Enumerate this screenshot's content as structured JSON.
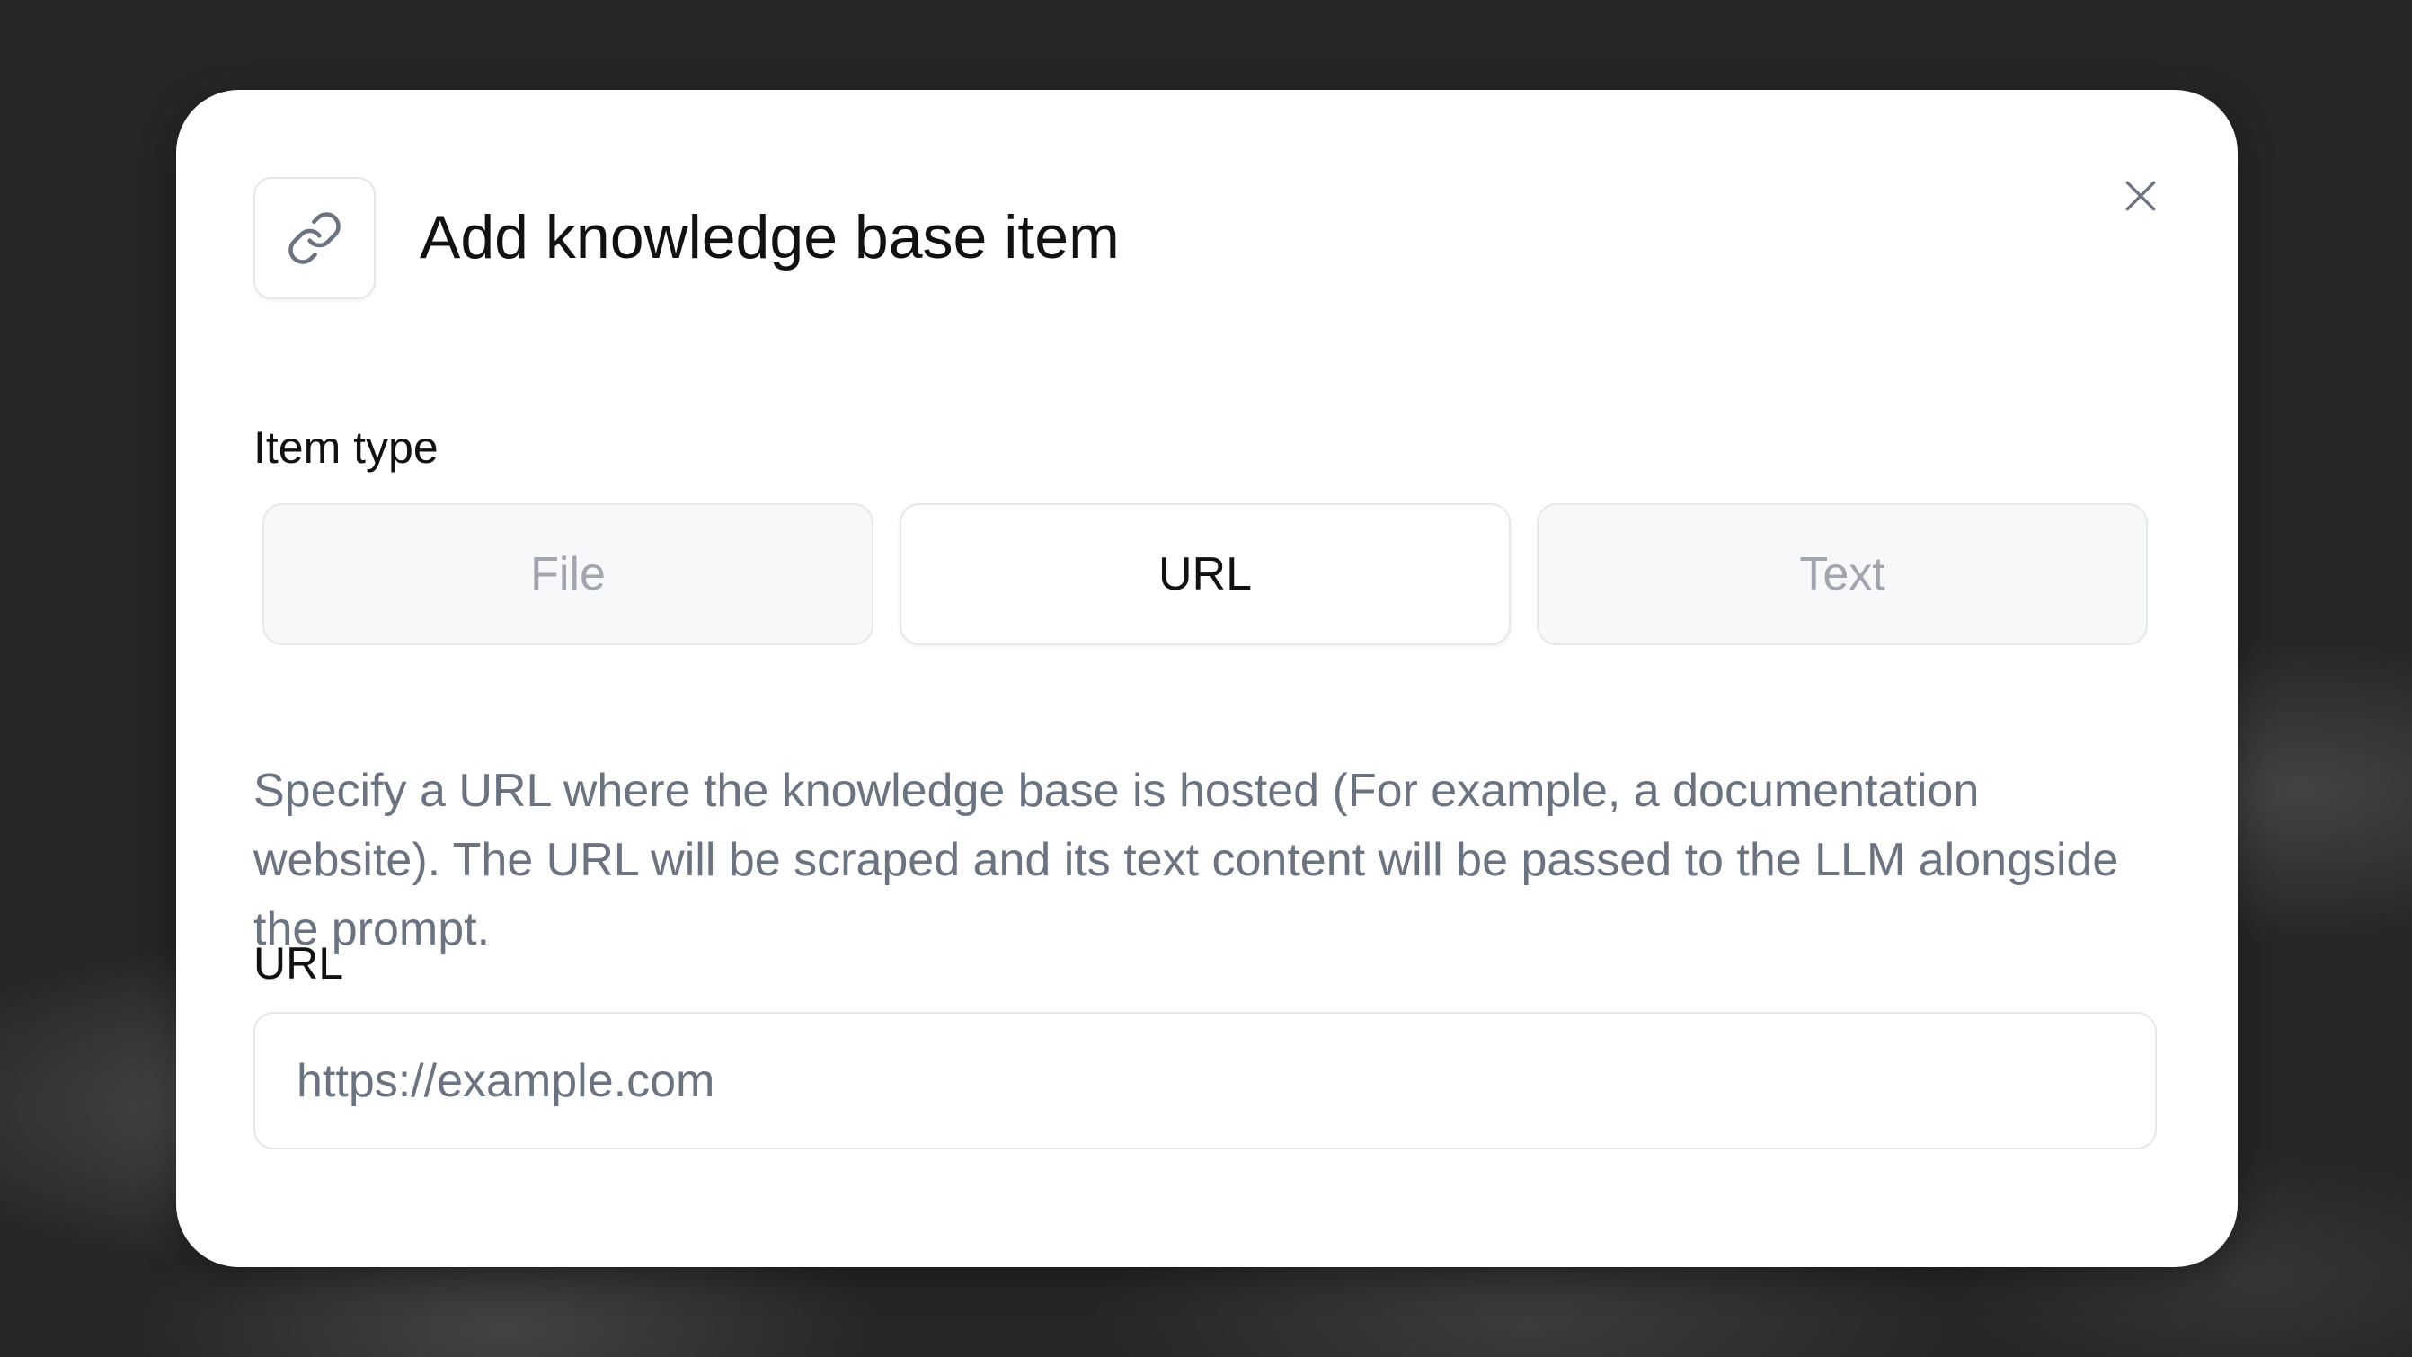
{
  "dialog": {
    "title": "Add knowledge base item",
    "header_icon": "link-icon",
    "close_icon": "close-icon"
  },
  "item_type": {
    "label": "Item type",
    "options": [
      "File",
      "URL",
      "Text"
    ],
    "selected": "URL"
  },
  "description": "Specify a URL where the knowledge base is hosted (For example, a documentation website). The URL will be scraped and its text content will be passed to the LLM alongside the prompt.",
  "url_field": {
    "label": "URL",
    "placeholder": "https://example.com",
    "value": ""
  }
}
